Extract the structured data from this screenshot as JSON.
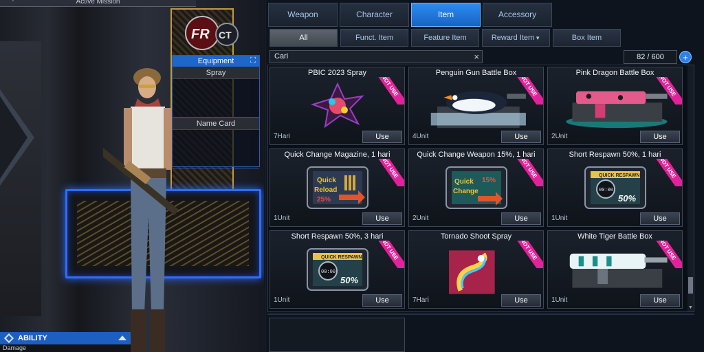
{
  "mission": {
    "label": "Active Mission",
    "plus": "+"
  },
  "equipment": {
    "header": "Equipment",
    "spray_label": "Spray",
    "namecard_label": "Name Card"
  },
  "ability": {
    "label": "ABILITY",
    "damage": "Damage"
  },
  "tabs": [
    {
      "label": "Weapon",
      "active": false
    },
    {
      "label": "Character",
      "active": false
    },
    {
      "label": "Item",
      "active": true
    },
    {
      "label": "Accessory",
      "active": false
    }
  ],
  "subtabs": [
    {
      "label": "All",
      "active": true
    },
    {
      "label": "Funct. Item",
      "active": false
    },
    {
      "label": "Feature Item",
      "active": false
    },
    {
      "label": "Reward Item",
      "active": false
    },
    {
      "label": "Box Item",
      "active": false
    }
  ],
  "search": {
    "value": "Cari",
    "clear": "×"
  },
  "count": {
    "value": "82 / 600"
  },
  "items": [
    {
      "title": "PBIC 2023 Spray",
      "qty": "7Hari",
      "use": "Use",
      "badge": "NOT USE",
      "icon": "spray-icon"
    },
    {
      "title": "Penguin Gun Battle Box",
      "qty": "4Unit",
      "use": "Use",
      "badge": "NOT USE",
      "icon": "penguin-gun-icon"
    },
    {
      "title": "Pink Dragon Battle Box",
      "qty": "2Unit",
      "use": "Use",
      "badge": "NOT USE",
      "icon": "dragon-gun-icon"
    },
    {
      "title": "Quick Change Magazine, 1 hari",
      "qty": "1Unit",
      "use": "Use",
      "badge": "NOT USE",
      "icon": "quick-reload-icon"
    },
    {
      "title": "Quick Change Weapon 15%, 1 hari",
      "qty": "2Unit",
      "use": "Use",
      "badge": "NOT USE",
      "icon": "quick-change-icon"
    },
    {
      "title": "Short Respawn 50%, 1 hari",
      "qty": "1Unit",
      "use": "Use",
      "badge": "NOT USE",
      "icon": "quick-respawn-icon"
    },
    {
      "title": "Short Respawn 50%, 3 hari",
      "qty": "1Unit",
      "use": "Use",
      "badge": "NOT USE",
      "icon": "quick-respawn-icon"
    },
    {
      "title": "Tornado Shoot Spray",
      "qty": "7Hari",
      "use": "Use",
      "badge": "NOT USE",
      "icon": "tornado-spray-icon"
    },
    {
      "title": "White Tiger Battle Box",
      "qty": "1Unit",
      "use": "Use",
      "badge": "NOT USE",
      "icon": "tiger-gun-icon"
    }
  ],
  "icon_text": {
    "reload_a": "Quick",
    "reload_b": "Reload",
    "reload_pct": "25%",
    "change_a": "Quick",
    "change_b": "Change",
    "change_pct": "15%",
    "respawn_banner": "QUICK RESPAWN",
    "respawn_clock": "00:00",
    "respawn_pct": "50%"
  },
  "colors": {
    "accent": "#2c8cf0",
    "badge": "#e2229a",
    "glow": "#2f6cff"
  }
}
